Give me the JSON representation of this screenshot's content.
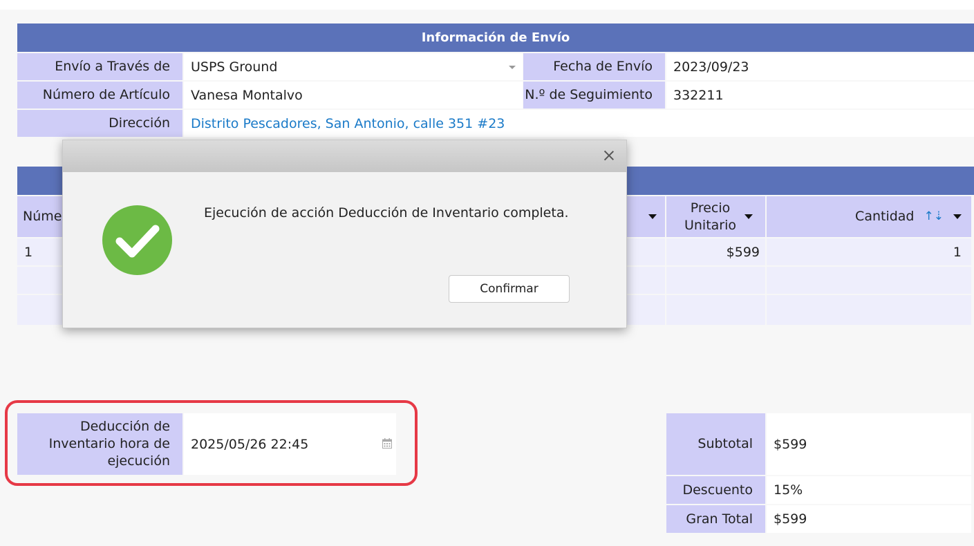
{
  "shipping": {
    "header": "Información de Envío",
    "ship_via_label": "Envío a Través de",
    "ship_via_value": "USPS Ground",
    "ship_date_label": "Fecha de Envío",
    "ship_date_value": "2023/09/23",
    "item_number_label": "Número de Artículo",
    "item_number_value": "Vanesa Montalvo",
    "tracking_label": "N.º de Seguimiento",
    "tracking_value": "332211",
    "address_label": "Dirección",
    "address_value": "Distrito Pescadores, San Antonio, calle 351 #23"
  },
  "items_table": {
    "col_number_partial": "Núme",
    "col_unit_price": "Precio Unitario",
    "col_quantity": "Cantidad",
    "rows": [
      {
        "number": "1",
        "unit_price": "$599",
        "quantity": "1"
      }
    ]
  },
  "inventory": {
    "label": "Deducción de Inventario hora de ejecución",
    "value": "2025/05/26 22:45"
  },
  "totals": {
    "subtotal_label": "Subtotal",
    "subtotal_value": "$599",
    "discount_label": "Descuento",
    "discount_value": "15%",
    "grand_total_label": "Gran Total",
    "grand_total_value": "$599"
  },
  "modal": {
    "message": "Ejecución de acción Deducción de Inventario completa.",
    "confirm_label": "Confirmar"
  },
  "colors": {
    "header_blue": "#5b72b9",
    "label_lavender": "#cfcdf7",
    "link_blue": "#1a7ac8",
    "success_green": "#6cba45",
    "highlight_red": "#e63946"
  }
}
